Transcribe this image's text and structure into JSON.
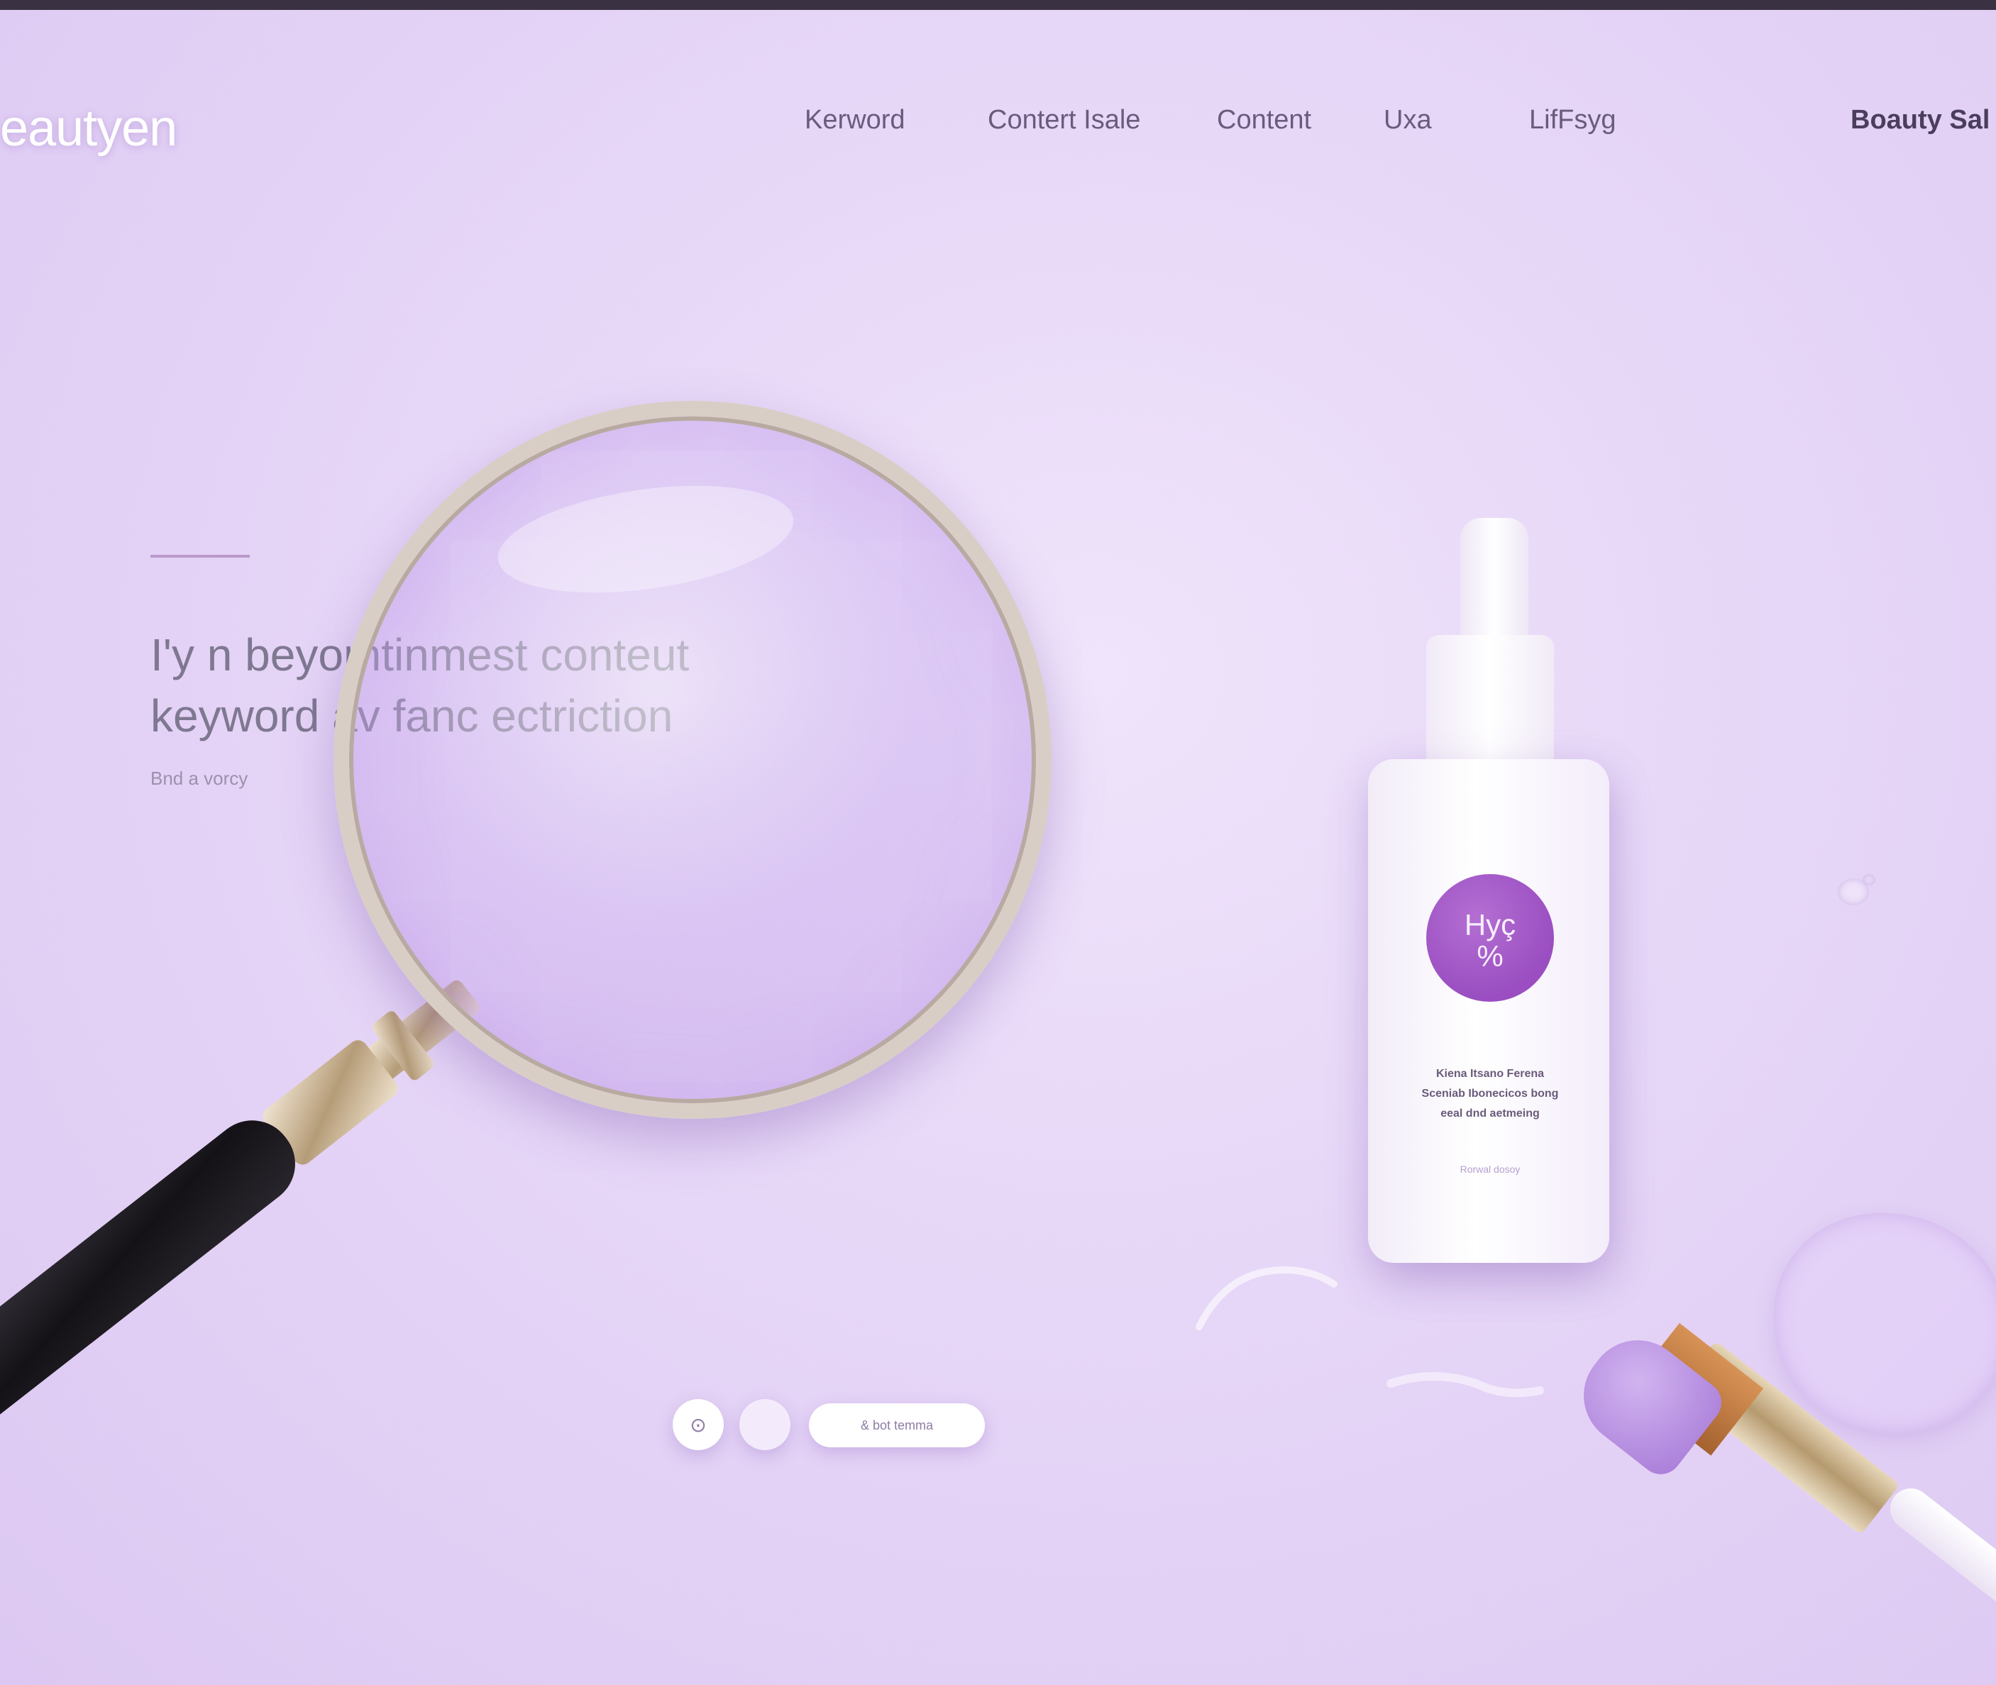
{
  "brand": {
    "logo_text": "eautyen"
  },
  "nav": {
    "items": [
      "Kerword",
      "Contert Isale",
      "Content",
      "Uxa",
      "LifFsyg"
    ],
    "cta": "Boauty Sal"
  },
  "hero": {
    "headline_line1": "I'y n beyomtinmest conteut",
    "headline_line2": "keyword av fanc ectriction",
    "link_text": "Bnd a vorcy"
  },
  "product": {
    "label_main": "Hyç",
    "label_sub": "%",
    "desc_lines": [
      "Kiena Itsano Ferena",
      "Sceniab Ibonecicos bong",
      "eeal dnd aetmeing"
    ],
    "small_text": "Rorwal dosoy"
  },
  "controls": {
    "icon1": "⊙",
    "pill_label": "& bot temma"
  },
  "colors": {
    "accent": "#9a4ec1",
    "background": "#e6d6f7",
    "nav_text": "#6a5b7e"
  }
}
